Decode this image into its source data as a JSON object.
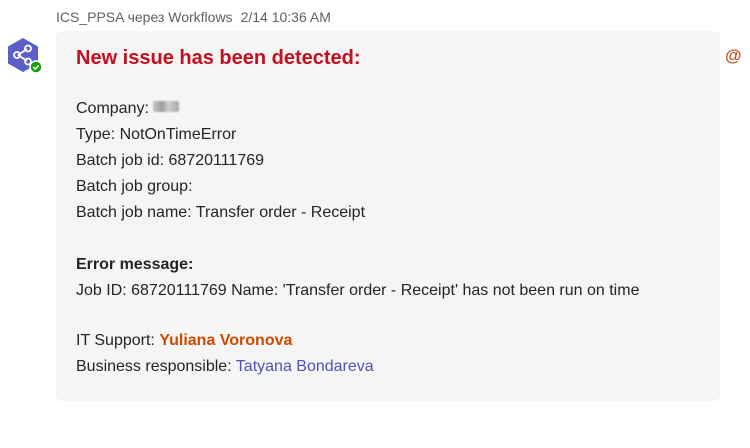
{
  "header": {
    "sender": "ICS_PPSA через Workflows",
    "date": "2/14",
    "time": "10:36 AM"
  },
  "mention_icon": "@",
  "message": {
    "title": "New issue has been detected:",
    "company_label": "Company:",
    "type_line": "Type: NotOnTimeError",
    "batch_id_line": "Batch job id: 68720111769",
    "batch_group_line": "Batch job group:",
    "batch_name_line": "Batch job name: Transfer order - Receipt",
    "error_heading": "Error message:",
    "error_text": "Job ID: 68720111769 Name: 'Transfer order - Receipt' has not been run on time",
    "it_support_label": "IT Support: ",
    "it_support_name": "Yuliana Voronova",
    "business_label": "Business responsible: ",
    "business_name": "Tatyana Bondareva"
  },
  "icons": {
    "avatar": "workflows-share-icon",
    "status": "online-check-icon"
  },
  "colors": {
    "title": "#c50f1f",
    "it_support_name": "#cc4a00",
    "business_name": "#4f52b2",
    "avatar_bg": "#5b5fc7",
    "status": "#13a10e",
    "mention": "#c4531f"
  }
}
